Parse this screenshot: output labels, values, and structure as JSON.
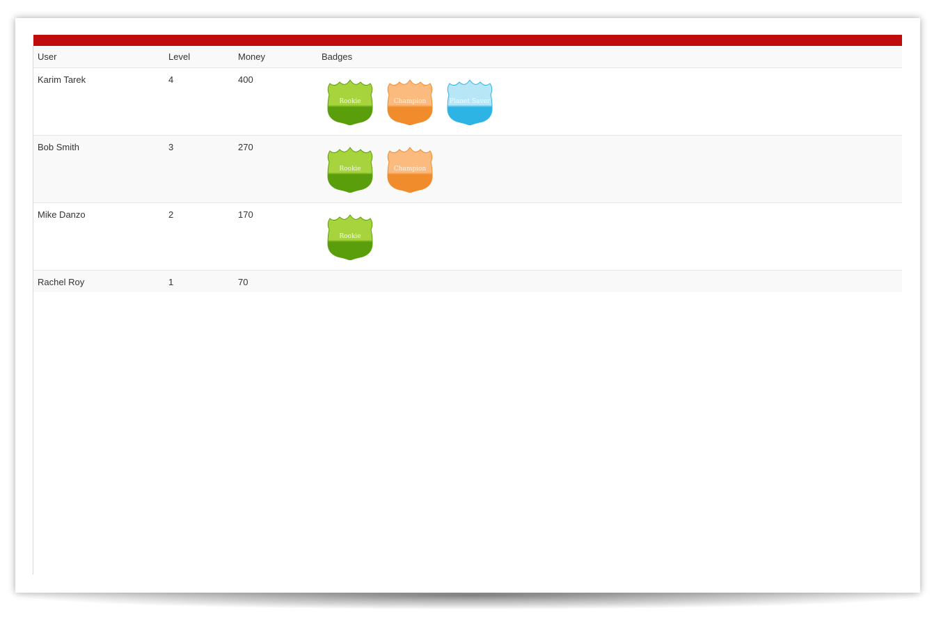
{
  "table": {
    "headers": {
      "user": "User",
      "level": "Level",
      "money": "Money",
      "badges": "Badges"
    },
    "rows": [
      {
        "user": "Karim Tarek",
        "level": "4",
        "money": "400",
        "badges": [
          "Rookie",
          "Champion",
          "Planet Saver"
        ]
      },
      {
        "user": "Bob Smith",
        "level": "3",
        "money": "270",
        "badges": [
          "Rookie",
          "Champion"
        ]
      },
      {
        "user": "Mike Danzo",
        "level": "2",
        "money": "170",
        "badges": [
          "Rookie"
        ]
      },
      {
        "user": "Rachel Roy",
        "level": "1",
        "money": "70",
        "badges": []
      }
    ]
  },
  "badge_styles": {
    "Rookie": {
      "icon": "rookie-badge-icon",
      "top": "#a7d43c",
      "bottom": "#5a9e0b"
    },
    "Champion": {
      "icon": "champion-badge-icon",
      "top": "#fbbb7e",
      "bottom": "#f08c2c"
    },
    "Planet Saver": {
      "icon": "planet-saver-badge-icon",
      "top": "#b7e6f7",
      "bottom": "#2db3e4"
    }
  },
  "colors": {
    "header_bar": "#bf0d0d"
  }
}
